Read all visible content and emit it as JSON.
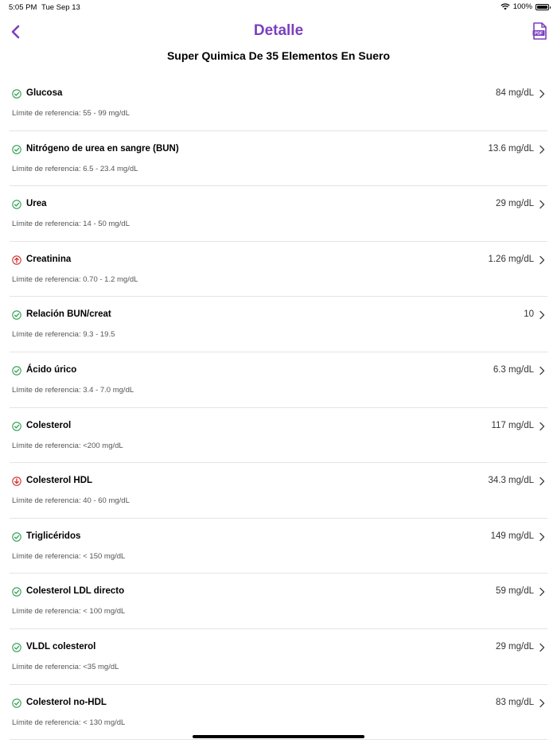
{
  "status_bar": {
    "time": "5:05 PM",
    "date": "Tue Sep 13",
    "battery": "100%"
  },
  "nav": {
    "title": "Detalle",
    "back_icon": "chevron-left-icon",
    "pdf_icon": "pdf-file-icon",
    "pdf_label": "PDF"
  },
  "subtitle": "Super Quimica De 35 Elementos En Suero",
  "colors": {
    "accent": "#7b3fbf",
    "normal": "#2e9e4f",
    "abnormal": "#d32f2f"
  },
  "results": [
    {
      "name": "Glucosa",
      "value": "84 mg/dL",
      "reference": "Límite de referencia: 55 - 99 mg/dL",
      "status": "normal",
      "icon": "check-circle-icon"
    },
    {
      "name": "Nitrógeno de urea en sangre (BUN)",
      "value": "13.6 mg/dL",
      "reference": "Límite de referencia: 6.5 - 23.4 mg/dL",
      "status": "normal",
      "icon": "check-circle-icon"
    },
    {
      "name": "Urea",
      "value": "29 mg/dL",
      "reference": "Límite de referencia: 14 - 50 mg/dL",
      "status": "normal",
      "icon": "check-circle-icon"
    },
    {
      "name": "Creatinina",
      "value": "1.26 mg/dL",
      "reference": "Límite de referencia: 0.70 - 1.2 mg/dL",
      "status": "high",
      "icon": "arrow-up-circle-icon"
    },
    {
      "name": "Relación BUN/creat",
      "value": "10",
      "reference": "Límite de referencia: 9.3 - 19.5",
      "status": "normal",
      "icon": "check-circle-icon"
    },
    {
      "name": "Ácido úrico",
      "value": "6.3 mg/dL",
      "reference": "Límite de referencia: 3.4 - 7.0 mg/dL",
      "status": "normal",
      "icon": "check-circle-icon"
    },
    {
      "name": "Colesterol",
      "value": "117 mg/dL",
      "reference": "Límite de referencia: <200 mg/dL",
      "status": "normal",
      "icon": "check-circle-icon"
    },
    {
      "name": "Colesterol HDL",
      "value": "34.3 mg/dL",
      "reference": "Límite de referencia: 40 - 60 mg/dL",
      "status": "low",
      "icon": "arrow-down-circle-icon"
    },
    {
      "name": "Triglicéridos",
      "value": "149 mg/dL",
      "reference": "Límite de referencia: < 150 mg/dL",
      "status": "normal",
      "icon": "check-circle-icon"
    },
    {
      "name": "Colesterol LDL directo",
      "value": "59 mg/dL",
      "reference": "Límite de referencia: < 100 mg/dL",
      "status": "normal",
      "icon": "check-circle-icon"
    },
    {
      "name": "VLDL colesterol",
      "value": "29 mg/dL",
      "reference": "Límite de referencia: <35 mg/dL",
      "status": "normal",
      "icon": "check-circle-icon"
    },
    {
      "name": "Colesterol no-HDL",
      "value": "83 mg/dL",
      "reference": "Límite de referencia: < 130 mg/dL",
      "status": "normal",
      "icon": "check-circle-icon"
    }
  ]
}
